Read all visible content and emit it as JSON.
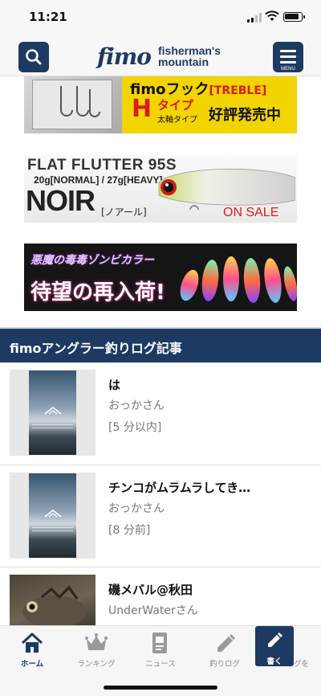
{
  "status_bar": {
    "time": "11:21"
  },
  "header": {
    "logo_script": "fimo",
    "logo_line1": "fisherman's",
    "logo_line2": "mountain",
    "menu_label": "MENU"
  },
  "banners": {
    "hook": {
      "title": "fimoフック",
      "tag": "[TREBLE]",
      "type_letter": "H",
      "type_word": "タイプ",
      "type_sub": "太軸タイプ",
      "status": "好評発売中"
    },
    "noir": {
      "title": "FLAT FLUTTER 95S",
      "weights": "20g[NORMAL] / 27g[HEAVY]",
      "name": "NOIR",
      "kana": "[ノアール]",
      "sale": "ON SALE"
    },
    "zombie": {
      "line1": "悪魔の毒毒ゾンビカラー",
      "line2": "待望の再入荷!"
    }
  },
  "section": {
    "title": "fimoアングラー釣りログ記事"
  },
  "articles": [
    {
      "title": "は",
      "author": "おっかさん",
      "time": "[5 分以内]"
    },
    {
      "title": "チンコがムラムラしてき…",
      "author": "おっかさん",
      "time": "[8 分前]"
    },
    {
      "title": "磯メバル@秋田",
      "author": "UnderWaterさん",
      "time": ""
    }
  ],
  "tabs": {
    "home": "ホーム",
    "ranking": "ランキング",
    "news": "ニュース",
    "log": "釣りログ",
    "post": "書く",
    "partial": "グを"
  },
  "colors": {
    "brand": "#1d3a63",
    "sale_red": "#e01818",
    "hook_yellow": "#f2d400"
  }
}
